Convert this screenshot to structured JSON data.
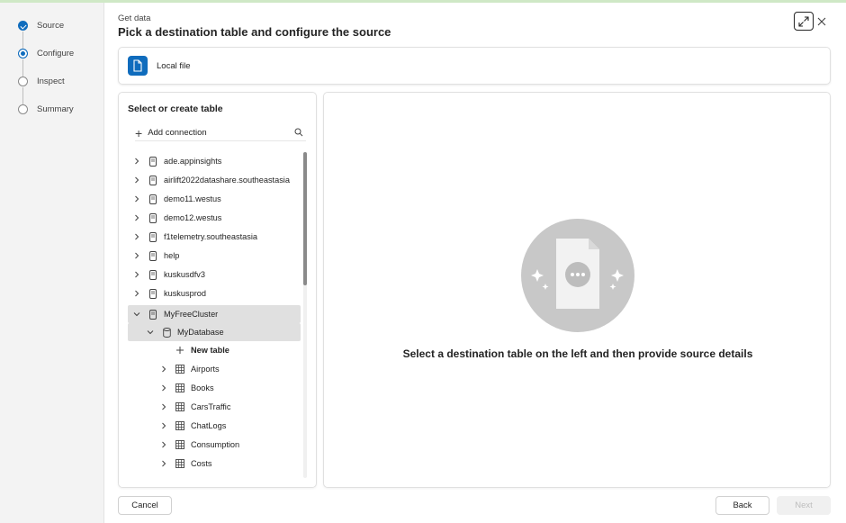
{
  "wizard": {
    "steps": [
      {
        "label": "Source",
        "state": "done"
      },
      {
        "label": "Configure",
        "state": "current"
      },
      {
        "label": "Inspect",
        "state": "pending"
      },
      {
        "label": "Summary",
        "state": "pending"
      }
    ]
  },
  "header": {
    "eyebrow": "Get data",
    "title": "Pick a destination table and configure the source"
  },
  "source": {
    "label": "Local file"
  },
  "left_panel": {
    "title": "Select or create table",
    "add_connection": "Add connection",
    "tree": [
      {
        "label": "ade.appinsights",
        "type": "cluster",
        "expanded": false
      },
      {
        "label": "airlift2022datashare.southeastasia",
        "type": "cluster",
        "expanded": false
      },
      {
        "label": "demo11.westus",
        "type": "cluster",
        "expanded": false
      },
      {
        "label": "demo12.westus",
        "type": "cluster",
        "expanded": false
      },
      {
        "label": "f1telemetry.southeastasia",
        "type": "cluster",
        "expanded": false
      },
      {
        "label": "help",
        "type": "cluster",
        "expanded": false
      },
      {
        "label": "kuskusdfv3",
        "type": "cluster",
        "expanded": false
      },
      {
        "label": "kuskusprod",
        "type": "cluster",
        "expanded": false
      },
      {
        "label": "MyFreeCluster",
        "type": "cluster",
        "expanded": true,
        "selected": true
      },
      {
        "label": "MyDatabase",
        "type": "database",
        "expanded": true,
        "selected": true
      },
      {
        "label": "New table",
        "type": "new-table"
      },
      {
        "label": "Airports",
        "type": "table"
      },
      {
        "label": "Books",
        "type": "table"
      },
      {
        "label": "CarsTraffic",
        "type": "table"
      },
      {
        "label": "ChatLogs",
        "type": "table"
      },
      {
        "label": "Consumption",
        "type": "table"
      },
      {
        "label": "Costs",
        "type": "table"
      }
    ]
  },
  "right_panel": {
    "message": "Select a destination table on the left and then provide source details"
  },
  "footer": {
    "cancel": "Cancel",
    "back": "Back",
    "next": "Next"
  },
  "colors": {
    "accent": "#0f6cbd",
    "selected_row": "#e0e0e0",
    "illustration": "#c8c8c8"
  }
}
